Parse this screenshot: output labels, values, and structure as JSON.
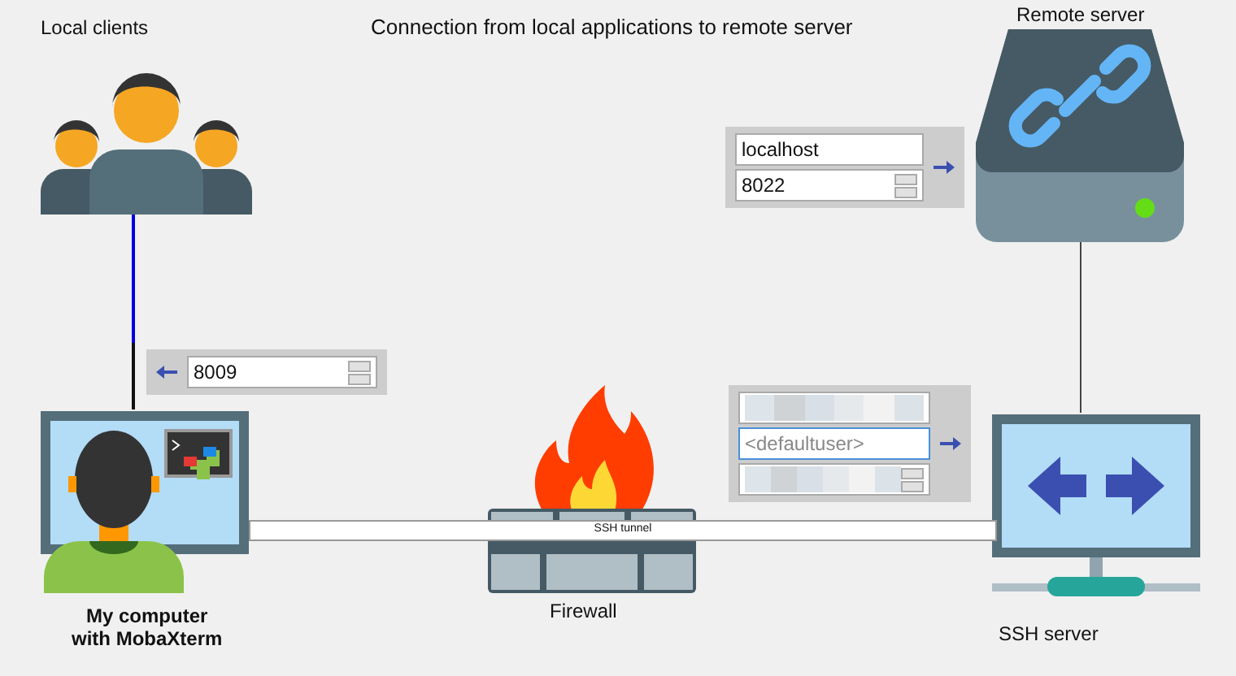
{
  "title": "Connection from local applications to remote server",
  "nodes": [
    {
      "kind": "clients",
      "label": "Local clients"
    },
    {
      "kind": "server",
      "label": "Remote server"
    },
    {
      "kind": "computer",
      "label": "My computer\nwith MobaXterm"
    },
    {
      "kind": "firewall",
      "label": "Firewall"
    },
    {
      "kind": "ssh",
      "label": "SSH server"
    }
  ],
  "remote_panel": {
    "fields": [
      {
        "kind": "text",
        "value": "localhost",
        "redacted": false,
        "focused": false
      },
      {
        "kind": "spin",
        "value": "8022",
        "redacted": false,
        "focused": false
      }
    ]
  },
  "local_panel": {
    "fields": [
      {
        "kind": "spin",
        "value": "8009",
        "redacted": false,
        "focused": false
      }
    ]
  },
  "ssh_panel": {
    "fields": [
      {
        "kind": "text",
        "redacted": true,
        "focused": false
      },
      {
        "kind": "text",
        "placeholder": "<defaultuser>",
        "redacted": false,
        "focused": true
      },
      {
        "kind": "spin",
        "redacted": true,
        "focused": false
      }
    ]
  },
  "tunnel": {
    "label": "SSH tunnel"
  }
}
